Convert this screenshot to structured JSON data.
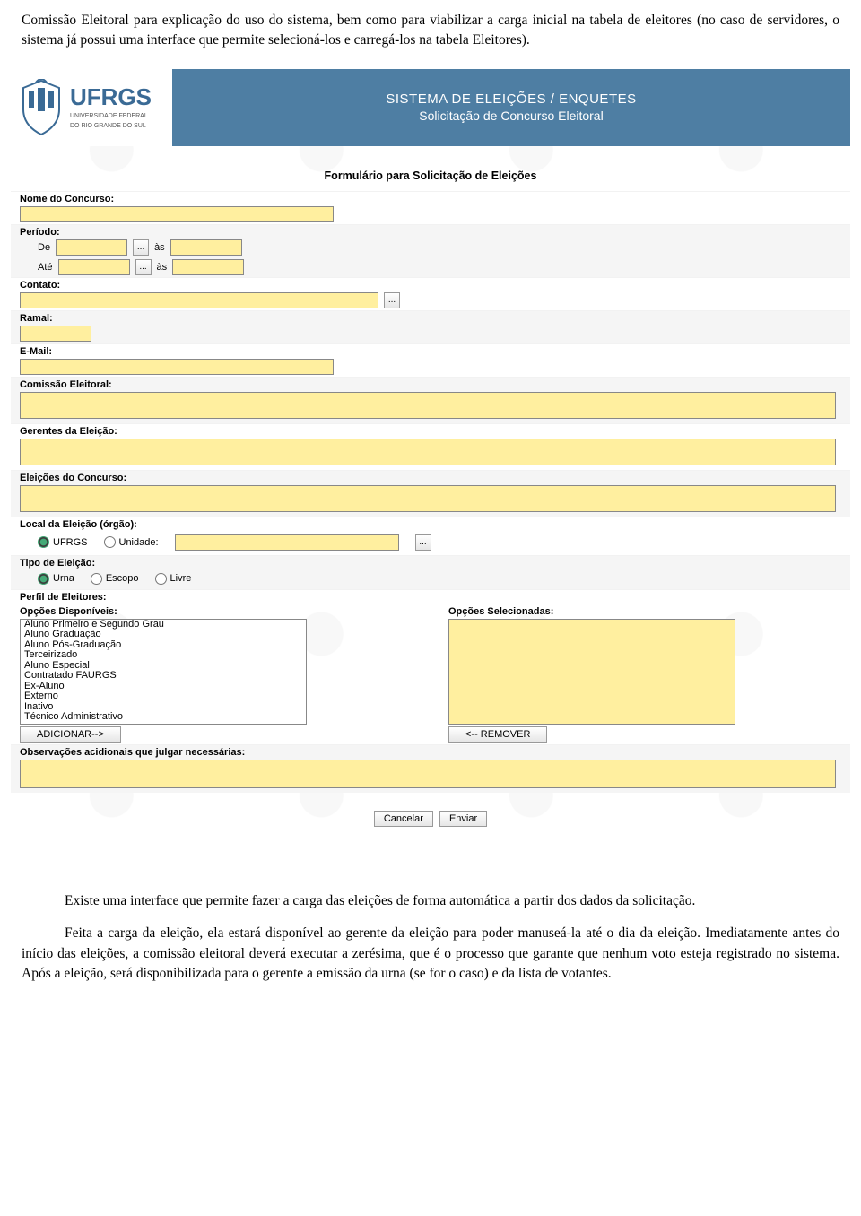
{
  "doc": {
    "para1": "Comissão Eleitoral para explicação do uso do sistema, bem como para viabilizar a carga inicial na tabela de eleitores (no caso de servidores, o sistema já possui uma interface que permite selecioná-los e carregá-los na tabela Eleitores).",
    "para2": "Existe uma interface que permite fazer a carga das eleições de forma automática a partir dos dados da solicitação.",
    "para3": "Feita a carga da eleição, ela estará disponível ao gerente da eleição para poder manuseá-la até o dia da eleição. Imediatamente antes do início das eleições, a comissão eleitoral deverá executar a zerésima, que é o processo que garante que nenhum voto esteja registrado no sistema. Após a eleição, será disponibilizada para o gerente a emissão da urna (se for o caso) e da lista de votantes."
  },
  "logo": {
    "name": "UFRGS",
    "sub1": "UNIVERSIDADE FEDERAL",
    "sub2": "DO RIO GRANDE DO SUL"
  },
  "header": {
    "title1": "SISTEMA DE ELEIÇÕES / ENQUETES",
    "title2": "Solicitação de Concurso Eleitoral"
  },
  "form": {
    "title": "Formulário para Solicitação de Eleições",
    "nome_concurso_label": "Nome do Concurso:",
    "periodo_label": "Período:",
    "de": "De",
    "as": "às",
    "ate": "Até",
    "contato_label": "Contato:",
    "ramal_label": "Ramal:",
    "email_label": "E-Mail:",
    "comissao_label": "Comissão Eleitoral:",
    "gerentes_label": "Gerentes da Eleição:",
    "eleicoes_label": "Eleições do Concurso:",
    "local_label": "Local da Eleição (órgão):",
    "local_opts": {
      "ufrgs": "UFRGS",
      "unidade": "Unidade:"
    },
    "tipo_label": "Tipo de Eleição:",
    "tipo_opts": {
      "urna": "Urna",
      "escopo": "Escopo",
      "livre": "Livre"
    },
    "perfil_label": "Perfil de Eleitores:",
    "disponiveis_label": "Opções Disponíveis:",
    "selecionadas_label": "Opções Selecionadas:",
    "opcoes": [
      "Aluno Primeiro e Segundo Grau",
      "Aluno Graduação",
      "Aluno Pós-Graduação",
      "Terceirizado",
      "Aluno Especial",
      "Contratado FAURGS",
      "Ex-Aluno",
      "Externo",
      "Inativo",
      "Técnico Administrativo"
    ],
    "btn_add": "ADICIONAR-->",
    "btn_rem": "<-- REMOVER",
    "obs_label": "Observações acidionais que julgar necessárias:",
    "btn_cancel": "Cancelar",
    "btn_send": "Enviar",
    "dots": "..."
  }
}
